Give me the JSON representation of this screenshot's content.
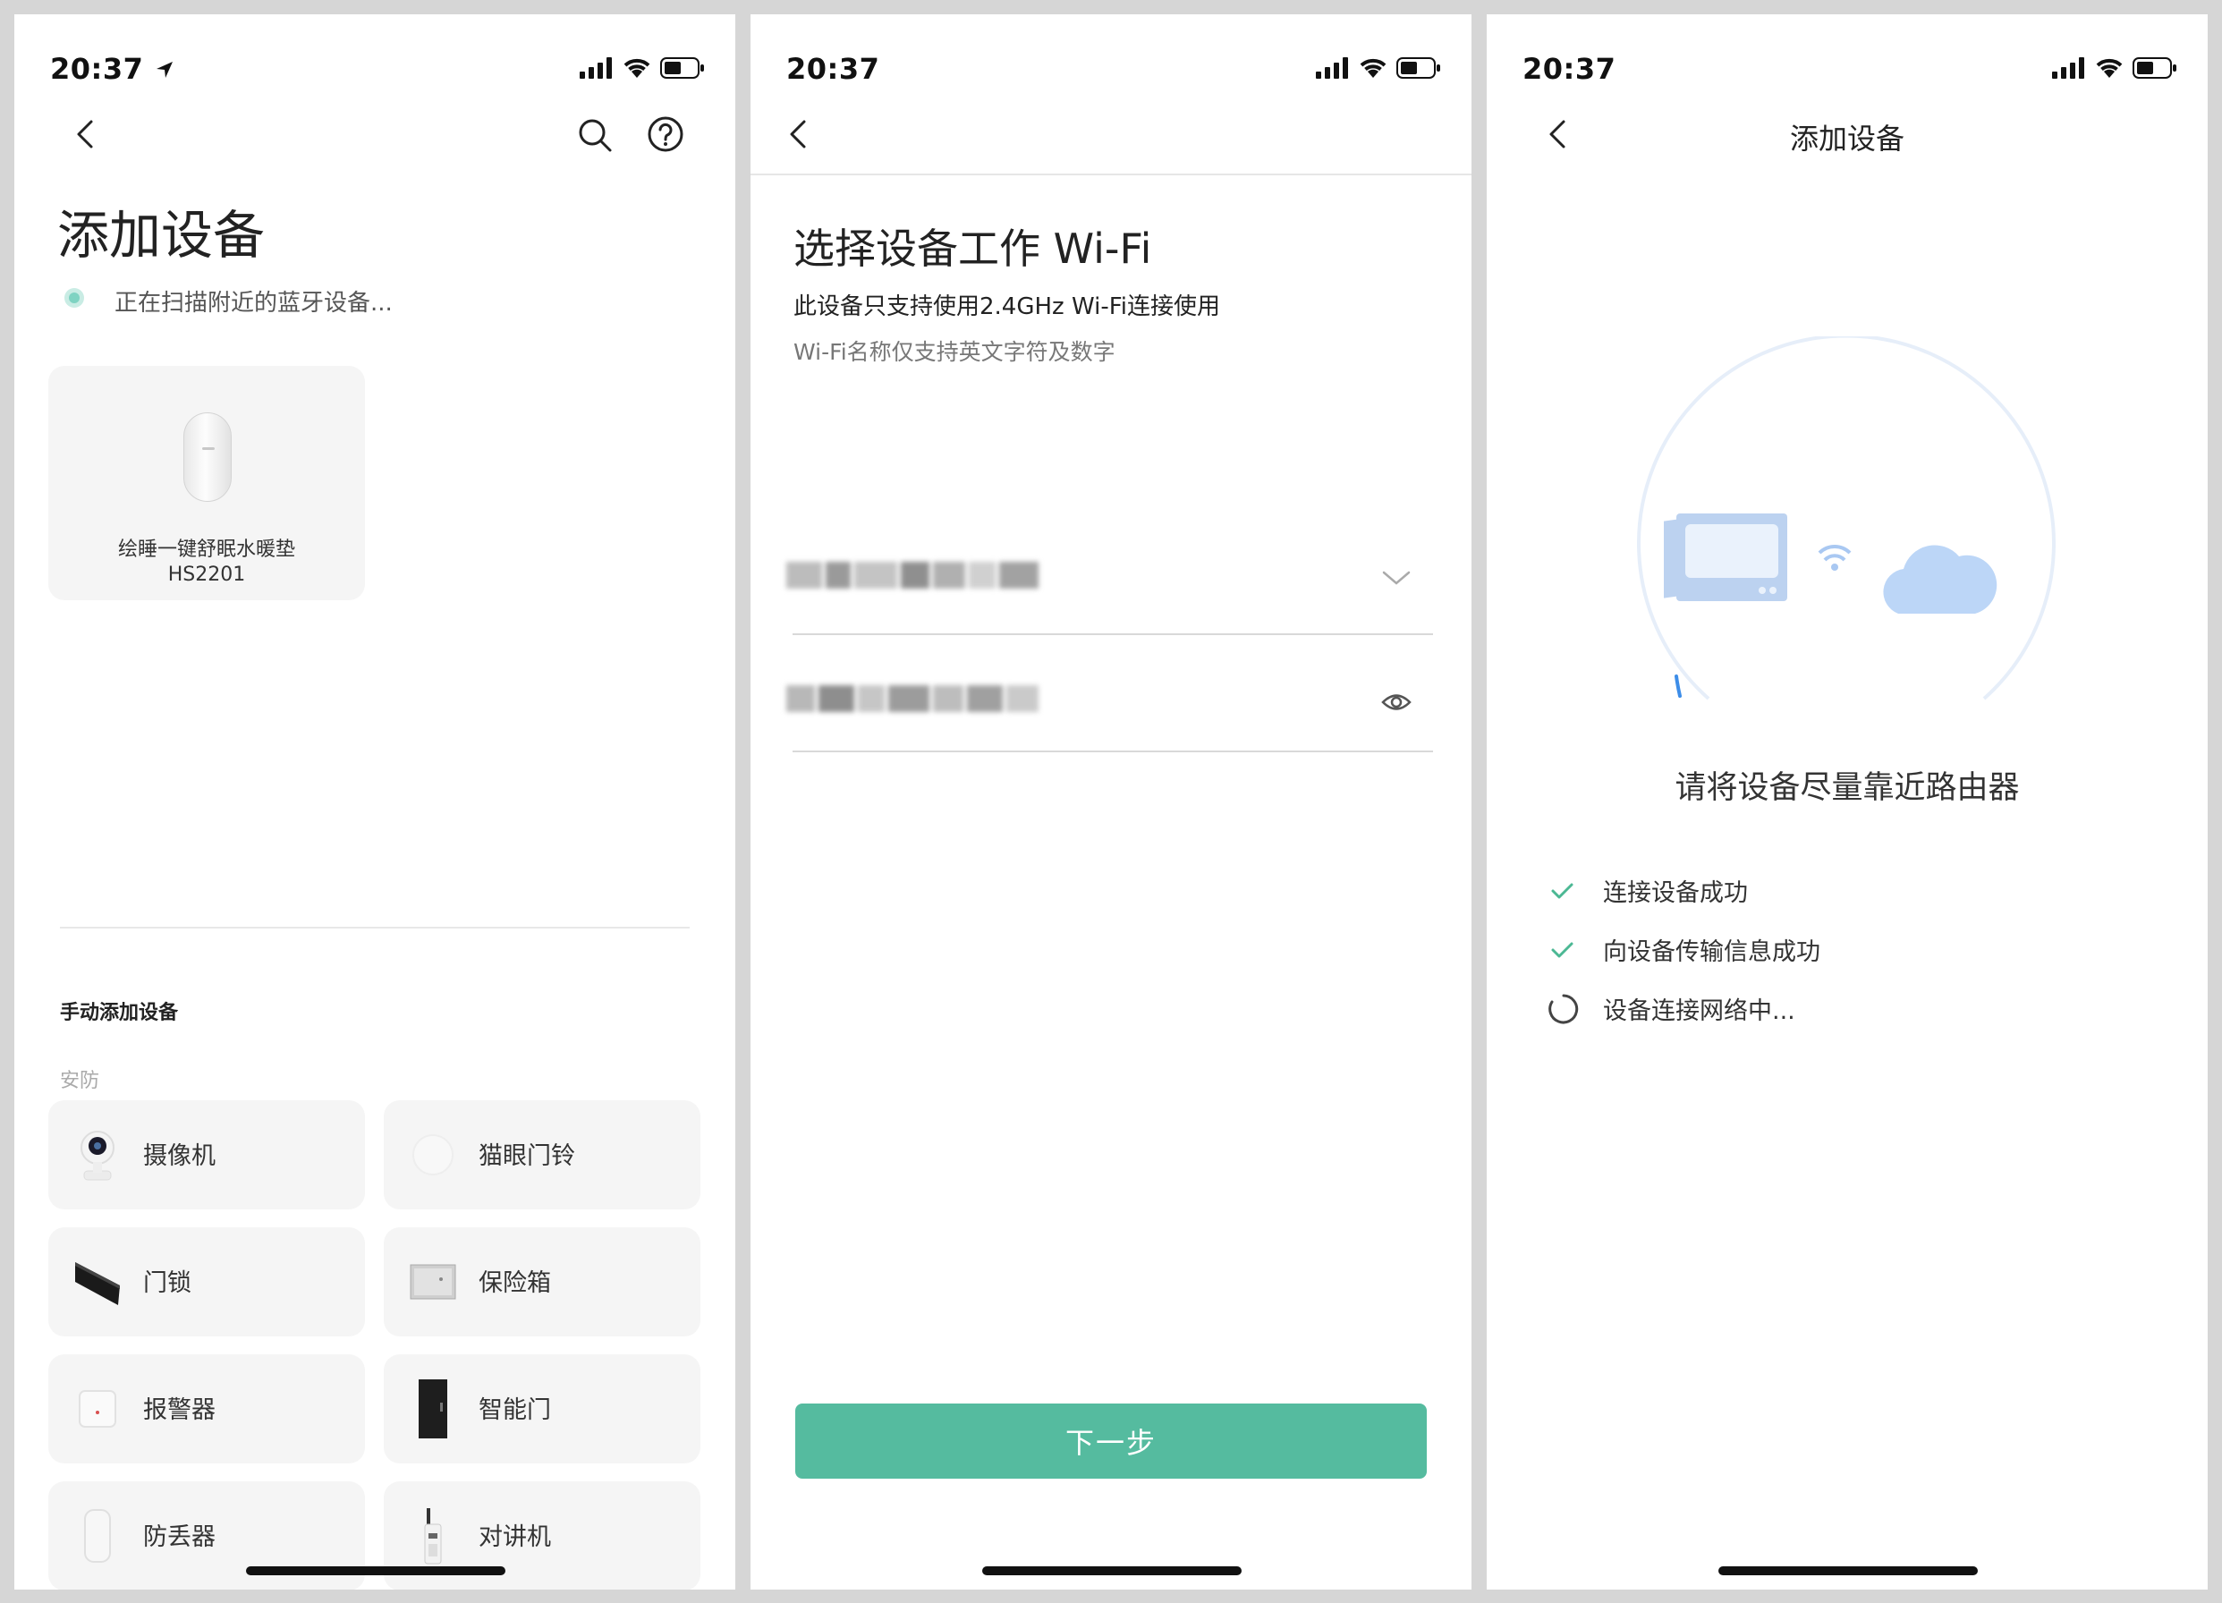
{
  "status_time": "20:37",
  "screen1": {
    "title": "添加设备",
    "scanning_text": "正在扫描附近的蓝牙设备...",
    "found_device": {
      "name": "绘睡一键舒眠水暖垫",
      "model": "HS2201"
    },
    "manual_section": "手动添加设备",
    "category_group": "安防",
    "categories": [
      "摄像机",
      "猫眼门铃",
      "门锁",
      "保险箱",
      "报警器",
      "智能门",
      "防丢器",
      "对讲机"
    ]
  },
  "screen2": {
    "title": "选择设备工作 Wi-Fi",
    "subtitle": "此设备只支持使用2.4GHz Wi-Fi连接使用",
    "hint": "Wi-Fi名称仅支持英文字符及数字",
    "next_button": "下一步"
  },
  "screen3": {
    "title": "添加设备",
    "instruction": "请将设备尽量靠近路由器",
    "steps": [
      {
        "text": "连接设备成功",
        "state": "done"
      },
      {
        "text": "向设备传输信息成功",
        "state": "done"
      },
      {
        "text": "设备连接网络中...",
        "state": "loading"
      }
    ]
  },
  "colors": {
    "accent": "#55bb9f",
    "check": "#4cb894",
    "scan_dot": "#7fd3c2",
    "illustration": "#c9dcf5"
  }
}
